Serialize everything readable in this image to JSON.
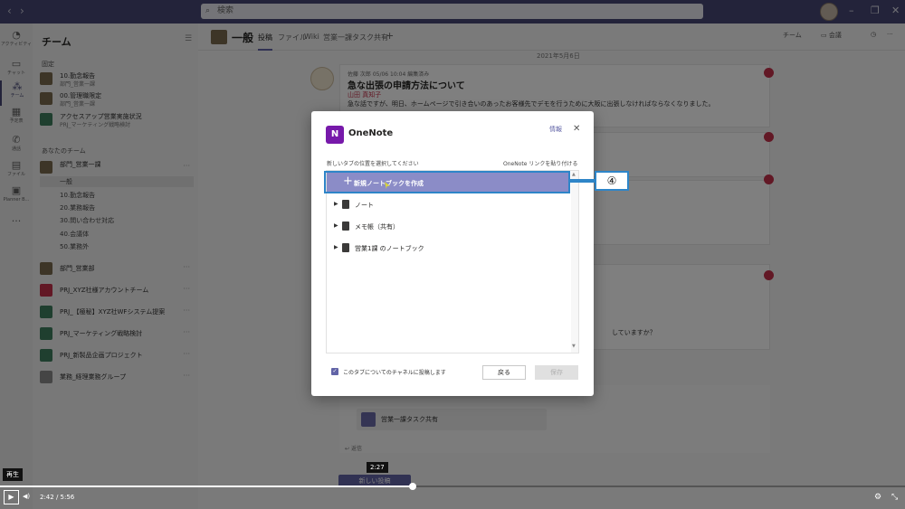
{
  "search": {
    "placeholder": "検索"
  },
  "rail": [
    {
      "label": "アクティビティ",
      "icon": "bell-icon"
    },
    {
      "label": "チャット",
      "icon": "chat-icon"
    },
    {
      "label": "チーム",
      "icon": "teams-icon"
    },
    {
      "label": "予定表",
      "icon": "calendar-icon"
    },
    {
      "label": "通話",
      "icon": "phone-icon"
    },
    {
      "label": "ファイル",
      "icon": "file-icon"
    },
    {
      "label": "Planner B...",
      "icon": "planner-icon"
    }
  ],
  "teams_panel": {
    "title": "チーム",
    "section_pinned": "固定",
    "pinned": [
      {
        "name": "10.勤念報告",
        "sub": "部門_営業一課"
      },
      {
        "name": "00.管理職限定",
        "sub": "部門_営業一課"
      },
      {
        "name": "アクセスアップ営業実施状況",
        "sub": "PRJ_マーケティング戦略検討"
      }
    ],
    "section_mine": "あなたのチーム",
    "team_main": "部門_営業一課",
    "channels": [
      "一般",
      "10.勤念報告",
      "20.業務報告",
      "30.問い合わせ対応",
      "40.会議体",
      "50.業務外"
    ],
    "others": [
      "部門_営業部",
      "PRJ_XYZ社様アカウントチーム",
      "PRJ_【極秘】XYZ社WFシステム提案",
      "PRJ_マーケティング戦略検討",
      "PRJ_新製品企画プロジェクト",
      "業務_経理業務グループ"
    ]
  },
  "channel_header": {
    "title": "一般",
    "tabs": [
      "投稿",
      "ファイル",
      "Wiki",
      "営業一課タスク共有"
    ],
    "add_tab": "+",
    "team_btn": "チーム",
    "meet_btn": "会議"
  },
  "feed": {
    "date": "2021年5月6日",
    "author": "佐藤 次郎  05/06 10:04  編集済み",
    "subject": "急な出張の申請方法について",
    "mention": "山田 真知子",
    "body": "急な話ですが、明日、ホームページで引き合いのあったお客様先でデモを行うために大阪に出張しなければならなくなりました。",
    "question_tail": "していますか？",
    "card_label": "営業一課タスク共有",
    "reply": "返信",
    "new_post": "新しい投稿"
  },
  "dialog": {
    "logo_letter": "N",
    "title": "OneNote",
    "info": "情報",
    "close": "✕",
    "prompt": "新しいタブの位置を選択してください",
    "paste_link": "OneNote リンクを貼り付ける",
    "create_label": "新規ノートブックを作成",
    "notebooks": [
      "ノート",
      "メモ帳（共有）",
      "営業1課 のノートブック"
    ],
    "checkbox_label": "このタブについてのチャネルに投稿します",
    "back": "戻る",
    "save": "保存",
    "callout": "④"
  },
  "player": {
    "tooltip_time": "2:27",
    "tooltip_play": "再生",
    "time": "2:42 / 5:56",
    "progress": 0.456
  }
}
